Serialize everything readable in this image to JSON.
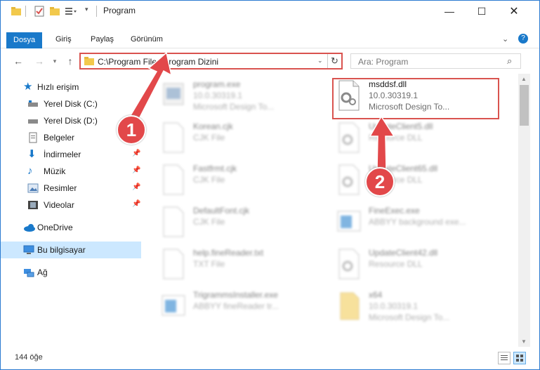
{
  "window": {
    "title": "Program",
    "controls": [
      "minimize",
      "maximize",
      "close"
    ]
  },
  "ribbon": {
    "tabs": [
      "Dosya",
      "Giriş",
      "Paylaş",
      "Görünüm"
    ]
  },
  "address": {
    "path": "C:\\Program Files\\Program Dizini"
  },
  "search": {
    "placeholder": "Ara: Program"
  },
  "sidebar": {
    "items": [
      {
        "label": "Hızlı erişim",
        "icon": "star-icon"
      },
      {
        "label": "Yerel Disk (C:)",
        "icon": "drive-icon"
      },
      {
        "label": "Yerel Disk (D:)",
        "icon": "drive-icon"
      },
      {
        "label": "Belgeler",
        "icon": "documents-icon"
      },
      {
        "label": "İndirmeler",
        "icon": "download-icon"
      },
      {
        "label": "Müzik",
        "icon": "music-icon"
      },
      {
        "label": "Resimler",
        "icon": "pictures-icon"
      },
      {
        "label": "Videolar",
        "icon": "video-icon"
      },
      {
        "label": "OneDrive",
        "icon": "cloud-icon"
      },
      {
        "label": "Bu bilgisayar",
        "icon": "computer-icon"
      },
      {
        "label": "Ağ",
        "icon": "network-icon"
      }
    ]
  },
  "files": [
    {
      "name": "program.exe",
      "line2": "10.0.30319.1",
      "line3": "Microsoft Design To..."
    },
    {
      "name": "msddsf.dll",
      "line2": "10.0.30319.1",
      "line3": "Microsoft Design To..."
    },
    {
      "name": "Korean.cjk",
      "line2": "CJK File",
      "line3": ""
    },
    {
      "name": "UpdateClient5.dll",
      "line2": "Resource DLL",
      "line3": ""
    },
    {
      "name": "Fastfrmt.cjk",
      "line2": "CJK File",
      "line3": ""
    },
    {
      "name": "UpdateClient65.dll",
      "line2": "Resource DLL",
      "line3": ""
    },
    {
      "name": "DefaultFont.cjk",
      "line2": "CJK File",
      "line3": ""
    },
    {
      "name": "FineExec.exe",
      "line2": "ABBYY background exe...",
      "line3": ""
    },
    {
      "name": "help.fineReader.txt",
      "line2": "TXT File",
      "line3": ""
    },
    {
      "name": "UpdateClient42.dll",
      "line2": "Resource DLL",
      "line3": ""
    },
    {
      "name": "TrigrammsInstaller.exe",
      "line2": "ABBYY fineReader tr...",
      "line3": ""
    },
    {
      "name": "x64",
      "line2": "10.0.30319.1",
      "line3": "Microsoft Design To..."
    }
  ],
  "status": {
    "count": "144 öğe"
  },
  "annotations": {
    "callout1": "1",
    "callout2": "2",
    "color": "#e2484a"
  }
}
